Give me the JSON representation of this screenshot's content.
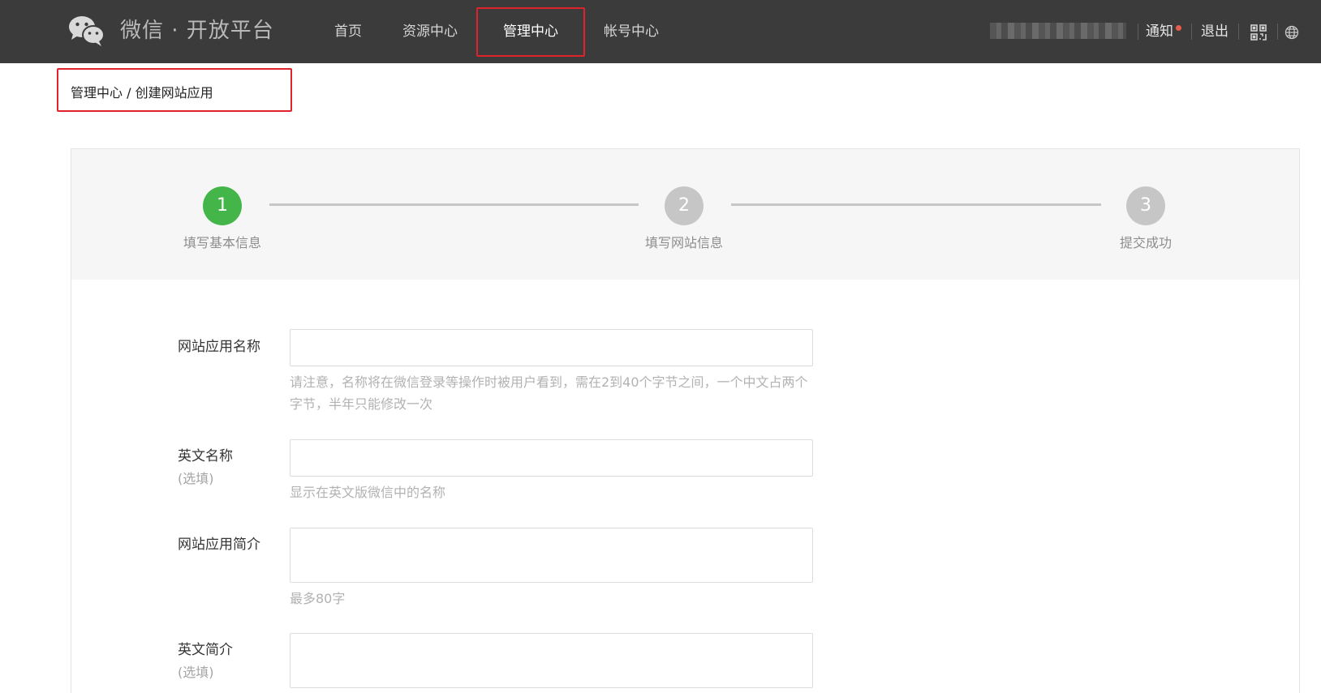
{
  "header": {
    "brand": "微信 · 开放平台",
    "nav": [
      "首页",
      "资源中心",
      "管理中心",
      "帐号中心"
    ],
    "active_nav": "管理中心",
    "notice_label": "通知",
    "logout_label": "退出"
  },
  "breadcrumb": {
    "text": "管理中心 / 创建网站应用"
  },
  "steps": [
    {
      "number": "1",
      "label": "填写基本信息",
      "state": "done"
    },
    {
      "number": "2",
      "label": "填写网站信息",
      "state": "todo"
    },
    {
      "number": "3",
      "label": "提交成功",
      "state": "todo"
    }
  ],
  "form": {
    "app_name": {
      "label": "网站应用名称",
      "value": "",
      "tip": "请注意，名称将在微信登录等操作时被用户看到，需在2到40个字节之间，一个中文占两个字节，半年只能修改一次"
    },
    "english_name": {
      "label": "英文名称",
      "optional": "(选填)",
      "value": "",
      "tip": "显示在英文版微信中的名称"
    },
    "app_intro": {
      "label": "网站应用简介",
      "value": "",
      "tip": "最多80字"
    },
    "english_intro": {
      "label": "英文简介",
      "optional": "(选填)",
      "value": ""
    }
  },
  "colors": {
    "topbar": "#3b3b3b",
    "step_done": "#44b549",
    "step_todo": "#c6c6c6",
    "highlight": "#e0222d"
  }
}
